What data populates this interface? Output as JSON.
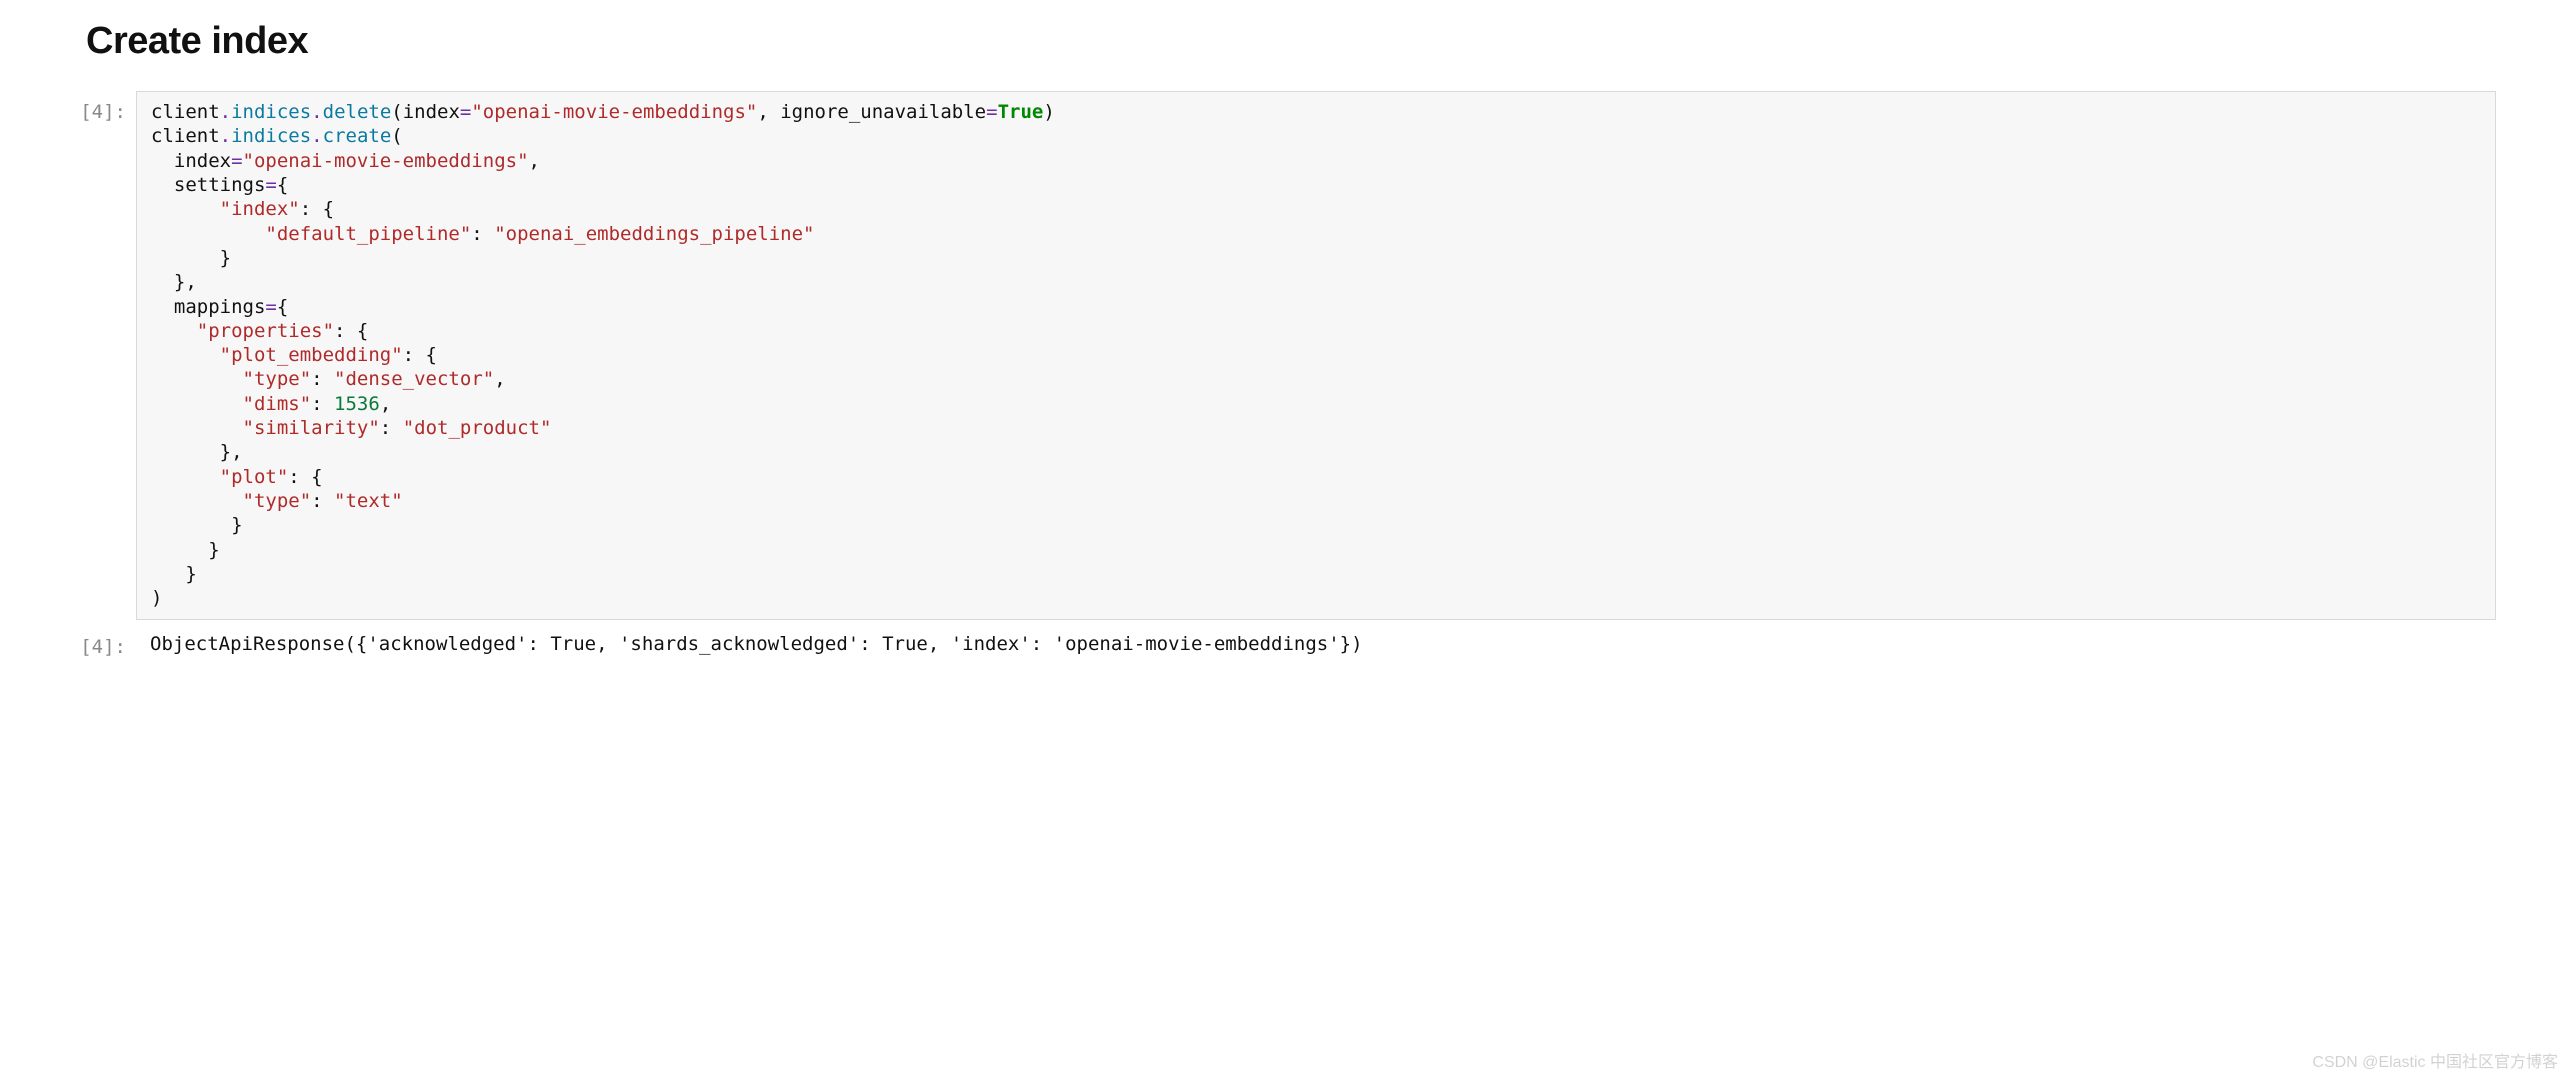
{
  "heading": "Create index",
  "input_cell": {
    "prompt": "[4]:",
    "tokens": [
      [
        "plain",
        "client"
      ],
      [
        "op",
        "."
      ],
      [
        "attr",
        "indices"
      ],
      [
        "op",
        "."
      ],
      [
        "attr",
        "delete"
      ],
      [
        "plain",
        "(index"
      ],
      [
        "op",
        "="
      ],
      [
        "str",
        "\"openai-movie-embeddings\""
      ],
      [
        "plain",
        ", ignore_unavailable"
      ],
      [
        "op",
        "="
      ],
      [
        "kw",
        "True"
      ],
      [
        "plain",
        ")"
      ],
      [
        "nl",
        ""
      ],
      [
        "plain",
        "client"
      ],
      [
        "op",
        "."
      ],
      [
        "attr",
        "indices"
      ],
      [
        "op",
        "."
      ],
      [
        "attr",
        "create"
      ],
      [
        "plain",
        "("
      ],
      [
        "nl",
        ""
      ],
      [
        "plain",
        "  index"
      ],
      [
        "op",
        "="
      ],
      [
        "str",
        "\"openai-movie-embeddings\""
      ],
      [
        "plain",
        ","
      ],
      [
        "nl",
        ""
      ],
      [
        "plain",
        "  settings"
      ],
      [
        "op",
        "="
      ],
      [
        "plain",
        "{"
      ],
      [
        "nl",
        ""
      ],
      [
        "plain",
        "      "
      ],
      [
        "str",
        "\"index\""
      ],
      [
        "plain",
        ": {"
      ],
      [
        "nl",
        ""
      ],
      [
        "plain",
        "          "
      ],
      [
        "str",
        "\"default_pipeline\""
      ],
      [
        "plain",
        ": "
      ],
      [
        "str",
        "\"openai_embeddings_pipeline\""
      ],
      [
        "nl",
        ""
      ],
      [
        "plain",
        "      }"
      ],
      [
        "nl",
        ""
      ],
      [
        "plain",
        "  },"
      ],
      [
        "nl",
        ""
      ],
      [
        "plain",
        "  mappings"
      ],
      [
        "op",
        "="
      ],
      [
        "plain",
        "{"
      ],
      [
        "nl",
        ""
      ],
      [
        "plain",
        "    "
      ],
      [
        "str",
        "\"properties\""
      ],
      [
        "plain",
        ": {"
      ],
      [
        "nl",
        ""
      ],
      [
        "plain",
        "      "
      ],
      [
        "str",
        "\"plot_embedding\""
      ],
      [
        "plain",
        ": {"
      ],
      [
        "nl",
        ""
      ],
      [
        "plain",
        "        "
      ],
      [
        "str",
        "\"type\""
      ],
      [
        "plain",
        ": "
      ],
      [
        "str",
        "\"dense_vector\""
      ],
      [
        "plain",
        ","
      ],
      [
        "nl",
        ""
      ],
      [
        "plain",
        "        "
      ],
      [
        "str",
        "\"dims\""
      ],
      [
        "plain",
        ": "
      ],
      [
        "num",
        "1536"
      ],
      [
        "plain",
        ","
      ],
      [
        "nl",
        ""
      ],
      [
        "plain",
        "        "
      ],
      [
        "str",
        "\"similarity\""
      ],
      [
        "plain",
        ": "
      ],
      [
        "str",
        "\"dot_product\""
      ],
      [
        "nl",
        ""
      ],
      [
        "plain",
        "      },"
      ],
      [
        "nl",
        ""
      ],
      [
        "plain",
        "      "
      ],
      [
        "str",
        "\"plot\""
      ],
      [
        "plain",
        ": {"
      ],
      [
        "nl",
        ""
      ],
      [
        "plain",
        "        "
      ],
      [
        "str",
        "\"type\""
      ],
      [
        "plain",
        ": "
      ],
      [
        "str",
        "\"text\""
      ],
      [
        "nl",
        ""
      ],
      [
        "plain",
        "       }"
      ],
      [
        "nl",
        ""
      ],
      [
        "plain",
        "     }"
      ],
      [
        "nl",
        ""
      ],
      [
        "plain",
        "   }"
      ],
      [
        "nl",
        ""
      ],
      [
        "plain",
        ")"
      ]
    ]
  },
  "output_cell": {
    "prompt": "[4]:",
    "text": "ObjectApiResponse({'acknowledged': True, 'shards_acknowledged': True, 'index': 'openai-movie-embeddings'})"
  },
  "watermark": "CSDN @Elastic 中国社区官方博客"
}
